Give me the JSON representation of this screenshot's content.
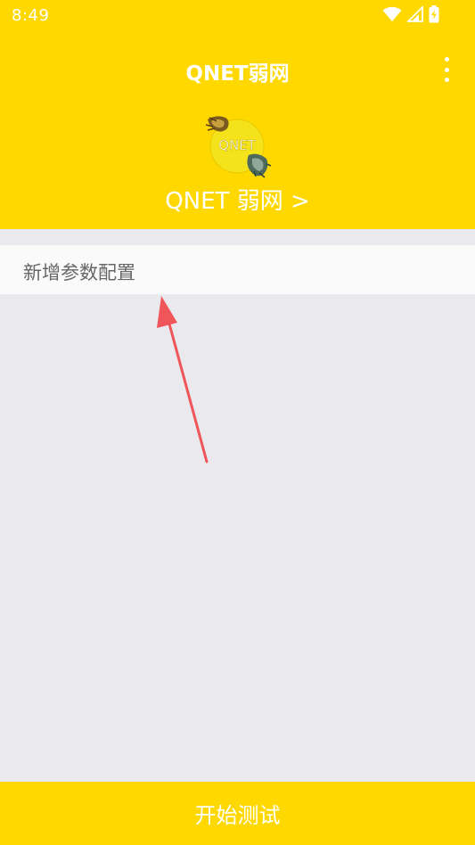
{
  "status_bar": {
    "time": "8:49",
    "icons": [
      "wifi-icon",
      "signal-icon",
      "battery-charging-icon"
    ]
  },
  "app_bar": {
    "title": "QNET弱网",
    "menu_icon": "more-vert-icon"
  },
  "profile": {
    "logo_text": "QNET",
    "name": "QNET 弱网 >"
  },
  "list": {
    "items": [
      {
        "label": "新增参数配置"
      }
    ]
  },
  "bottom_button": {
    "label": "开始测试"
  },
  "colors": {
    "primary": "#FFD800",
    "background": "#E9E9EE",
    "list_item_bg": "#FAFAFA",
    "list_text": "#666666",
    "annotation_arrow": "#F0555A"
  }
}
